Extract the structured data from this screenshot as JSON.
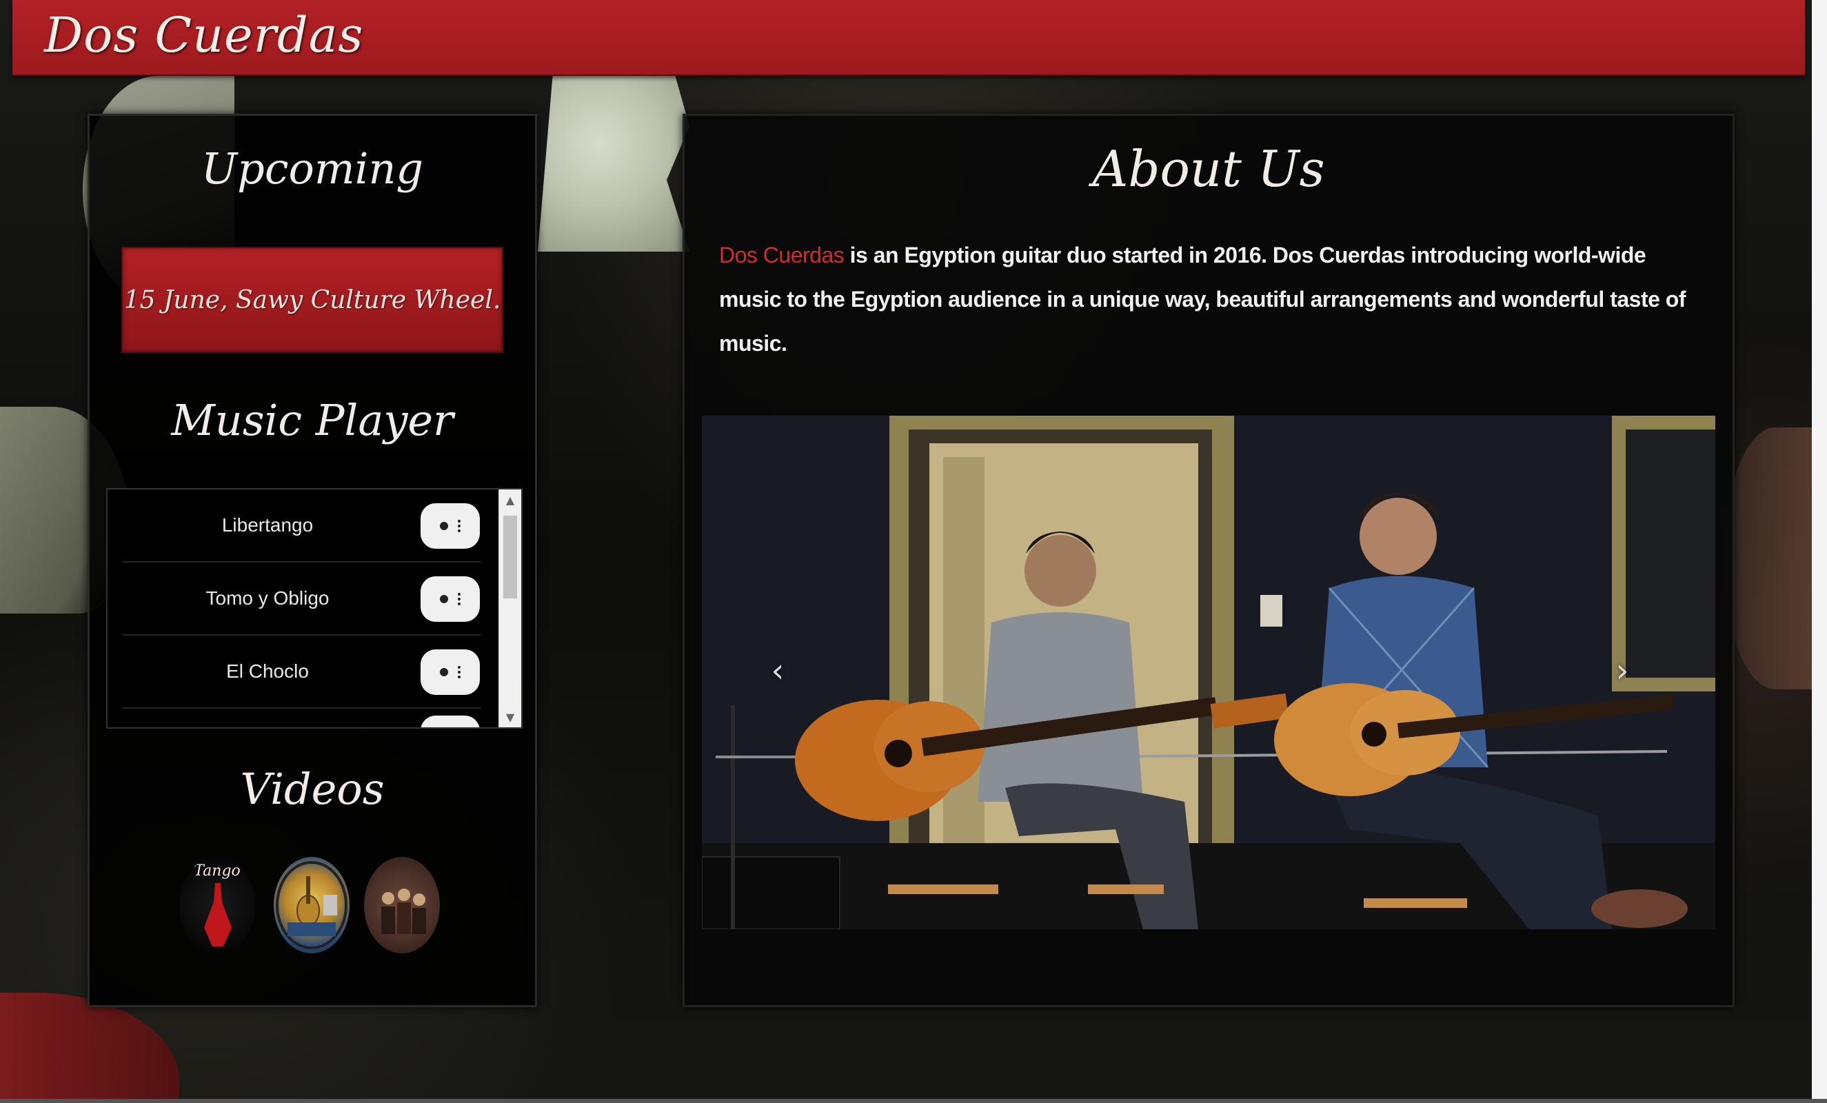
{
  "header": {
    "title": "Dos Cuerdas"
  },
  "sidebar": {
    "upcoming_title": "Upcoming",
    "event": "15 June, Sawy Culture Wheel.",
    "music_title": "Music Player",
    "tracks": [
      {
        "name": "Libertango"
      },
      {
        "name": "Tomo y Obligo"
      },
      {
        "name": "El Choclo"
      }
    ],
    "videos_title": "Videos",
    "videos": [
      {
        "label": "Tango",
        "icon": "tango-dancer-thumbnail"
      },
      {
        "icon": "musical-instruments-thumbnail"
      },
      {
        "icon": "orchestra-painting-thumbnail"
      }
    ]
  },
  "main": {
    "title": "About Us",
    "brand": "Dos Cuerdas",
    "text": " is an Egyption guitar duo started in 2016. Dos Cuerdas introducing world-wide music to the Egyption audience in a unique way, beautiful arrangements and wonderful taste of music.",
    "carousel": {
      "prev_icon": "chevron-left-icon",
      "next_icon": "chevron-right-icon",
      "prev_glyph": "‹",
      "next_glyph": "›",
      "image": "two-guitarists-photo"
    }
  },
  "colors": {
    "accent_red": "#b32124",
    "brand_text_red": "#d12d2f",
    "panel_bg": "#000000",
    "title_text": "#f1ece6"
  }
}
